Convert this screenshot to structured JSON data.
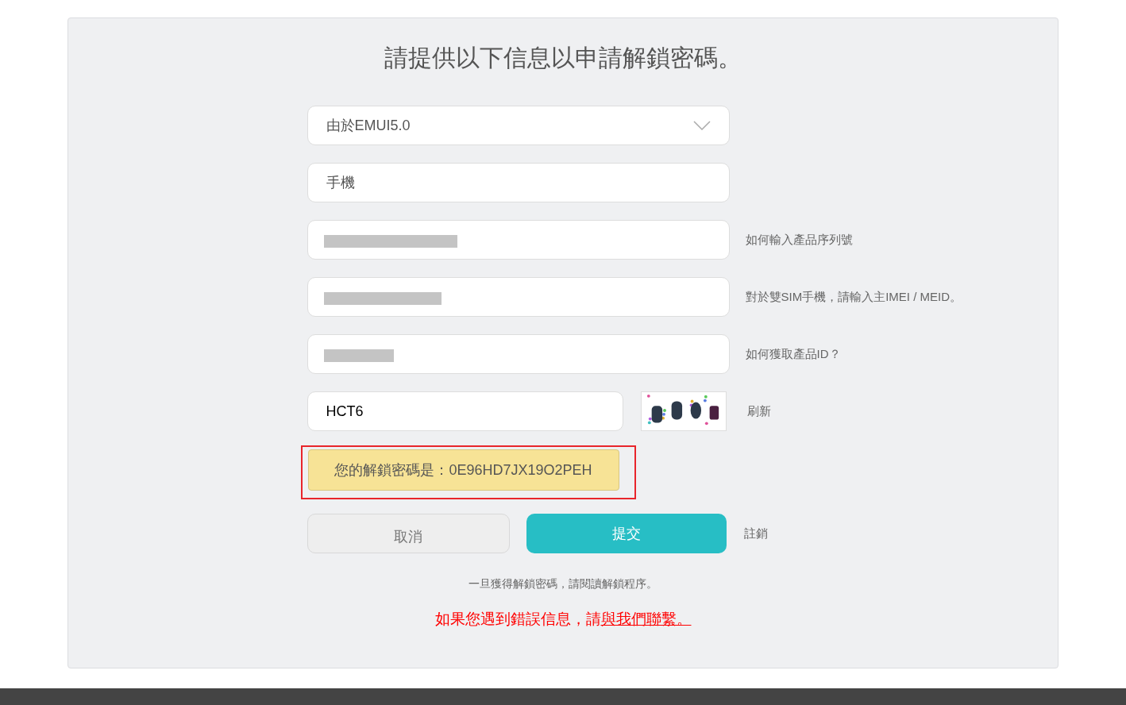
{
  "title": "請提供以下信息以申請解鎖密碼。",
  "fields": [
    {
      "kind": "select",
      "value": "由於EMUI5.0"
    },
    {
      "kind": "text",
      "value": "手機"
    },
    {
      "kind": "redacted",
      "hint": "如何輸入產品序列號"
    },
    {
      "kind": "redacted",
      "hint": "對於雙SIM手機，請輸入主IMEI / MEID。"
    },
    {
      "kind": "redacted",
      "hint": "如何獲取產品ID？"
    }
  ],
  "captcha": {
    "value": "HCT6",
    "refresh": "刷新"
  },
  "result": {
    "text": "您的解鎖密碼是：0E96HD7JX19O2PEH",
    "highlighted": true
  },
  "buttons": {
    "cancel": "取消",
    "submit": "提交",
    "logout": "註銷"
  },
  "note": "一旦獲得解鎖密碼，請閱讀解鎖程序。",
  "contact": {
    "text": "如果您遇到錯誤信息，請",
    "link": "與我們聯繫。"
  }
}
